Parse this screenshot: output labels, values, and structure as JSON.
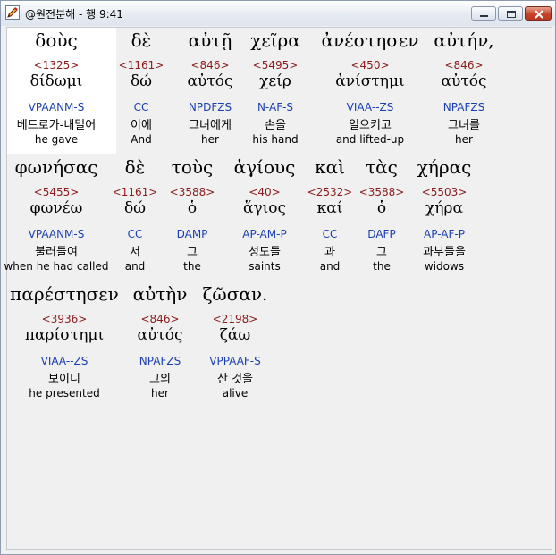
{
  "window": {
    "title": "@원전분해 - 행 9:41",
    "icon": "pencil-app-icon",
    "buttons": [
      "minimize-icon",
      "maximize-icon",
      "close-icon"
    ]
  },
  "rows": [
    {
      "words": [
        {
          "greek": "δοὺς",
          "strong": "<1325>",
          "lemma": "δίδωμι",
          "morph": "VPAANM-S",
          "korean": "베드로가-내밀어",
          "english": "he gave",
          "selected": true
        },
        {
          "greek": "δὲ",
          "strong": "<1161>",
          "lemma": "δώ",
          "morph": "CC",
          "korean": "이에",
          "english": "And"
        },
        {
          "greek": "αὐτῇ",
          "strong": "<846>",
          "lemma": "αὐτός",
          "morph": "NPDFZS",
          "korean": "그녀에게",
          "english": "her"
        },
        {
          "greek": "χεῖρα",
          "strong": "<5495>",
          "lemma": "χείρ",
          "morph": "N-AF-S",
          "korean": "손을",
          "english": "his hand"
        },
        {
          "greek": "ἀνέστησεν",
          "strong": "<450>",
          "lemma": "ἀνίστημι",
          "morph": "VIAA--ZS",
          "korean": "일으키고",
          "english": "and lifted-up"
        },
        {
          "greek": "αὐτήν,",
          "strong": "<846>",
          "lemma": "αὐτός",
          "morph": "NPAFZS",
          "korean": "그녀를",
          "english": "her"
        }
      ]
    },
    {
      "words": [
        {
          "greek": "φωνήσας",
          "strong": "<5455>",
          "lemma": "φωνέω",
          "morph": "VPAANM-S",
          "korean": "불러들여",
          "english": "when he had called"
        },
        {
          "greek": "δὲ",
          "strong": "<1161>",
          "lemma": "δώ",
          "morph": "CC",
          "korean": "서",
          "english": "and"
        },
        {
          "greek": "τοὺς",
          "strong": "<3588>",
          "lemma": "ὁ",
          "morph": "DAMP",
          "korean": "그",
          "english": "the"
        },
        {
          "greek": "ἁγίους",
          "strong": "<40>",
          "lemma": "ἅγιος",
          "morph": "AP-AM-P",
          "korean": "성도들",
          "english": "saints"
        },
        {
          "greek": "καὶ",
          "strong": "<2532>",
          "lemma": "καί",
          "morph": "CC",
          "korean": "과",
          "english": "and"
        },
        {
          "greek": "τὰς",
          "strong": "<3588>",
          "lemma": "ὁ",
          "morph": "DAFP",
          "korean": "그",
          "english": "the"
        },
        {
          "greek": "χήρας",
          "strong": "<5503>",
          "lemma": "χήρα",
          "morph": "AP-AF-P",
          "korean": "과부들을",
          "english": "widows"
        }
      ]
    },
    {
      "words": [
        {
          "greek": "παρέστησεν",
          "strong": "<3936>",
          "lemma": "παρίστημι",
          "morph": "VIAA--ZS",
          "korean": "보이니",
          "english": "he presented"
        },
        {
          "greek": "αὐτὴν",
          "strong": "<846>",
          "lemma": "αὐτός",
          "morph": "NPAFZS",
          "korean": "그의",
          "english": "her"
        },
        {
          "greek": "ζῶσαν.",
          "strong": "<2198>",
          "lemma": "ζάω",
          "morph": "VPPAAF-S",
          "korean": "산 것을",
          "english": "alive"
        }
      ]
    }
  ]
}
